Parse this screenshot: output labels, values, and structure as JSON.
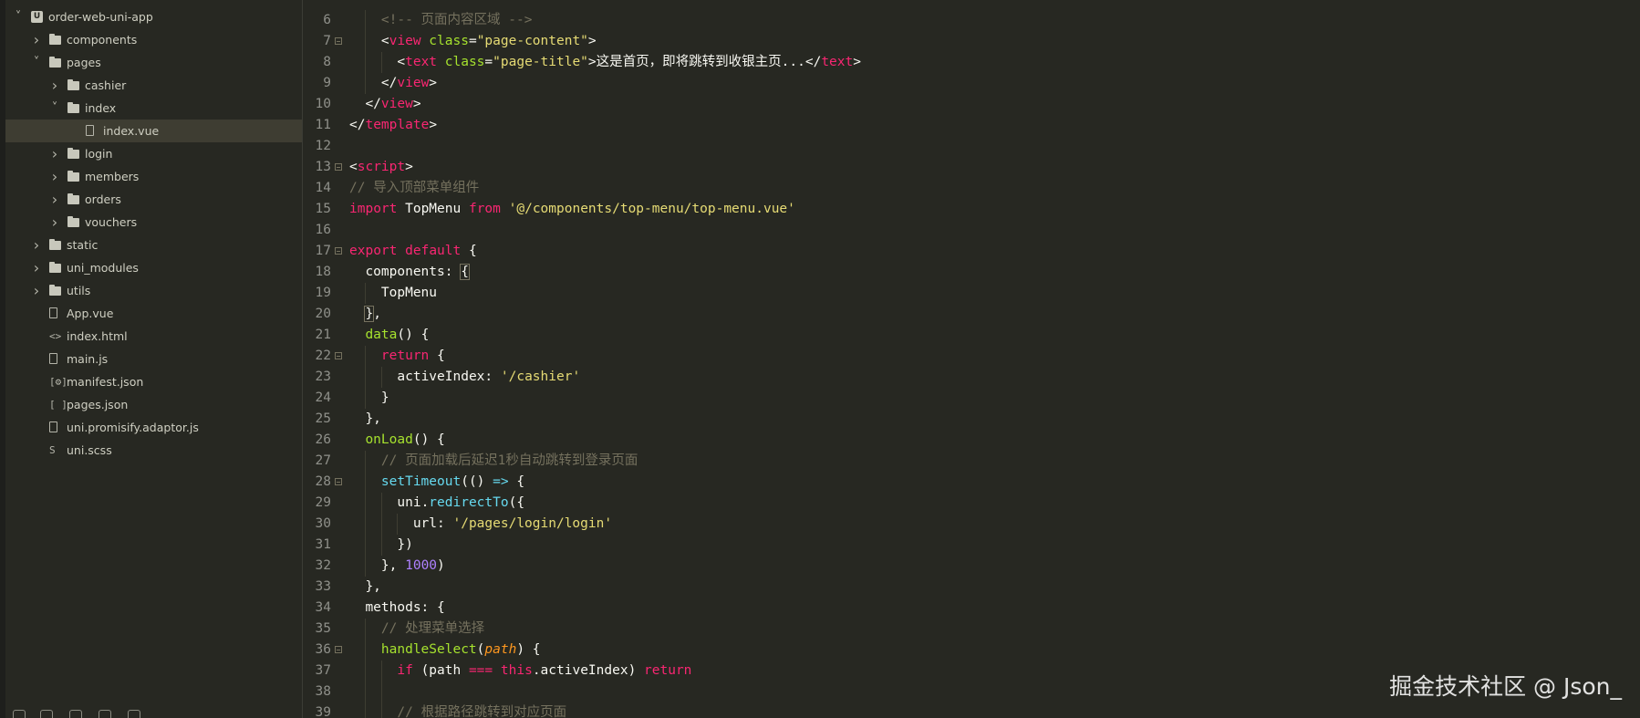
{
  "sidebar": {
    "items": [
      {
        "label": "order-web-uni-app",
        "depth": 0,
        "kind": "project",
        "expanded": true
      },
      {
        "label": "components",
        "depth": 1,
        "kind": "folder",
        "expanded": false
      },
      {
        "label": "pages",
        "depth": 1,
        "kind": "folder",
        "expanded": true
      },
      {
        "label": "cashier",
        "depth": 2,
        "kind": "folder",
        "expanded": false
      },
      {
        "label": "index",
        "depth": 2,
        "kind": "folder",
        "expanded": true
      },
      {
        "label": "index.vue",
        "depth": 3,
        "kind": "vue",
        "selected": true
      },
      {
        "label": "login",
        "depth": 2,
        "kind": "folder",
        "expanded": false
      },
      {
        "label": "members",
        "depth": 2,
        "kind": "folder",
        "expanded": false
      },
      {
        "label": "orders",
        "depth": 2,
        "kind": "folder",
        "expanded": false
      },
      {
        "label": "vouchers",
        "depth": 2,
        "kind": "folder",
        "expanded": false
      },
      {
        "label": "static",
        "depth": 1,
        "kind": "folder",
        "expanded": false
      },
      {
        "label": "uni_modules",
        "depth": 1,
        "kind": "folder",
        "expanded": false
      },
      {
        "label": "utils",
        "depth": 1,
        "kind": "folder",
        "expanded": false
      },
      {
        "label": "App.vue",
        "depth": 1,
        "kind": "vue"
      },
      {
        "label": "index.html",
        "depth": 1,
        "kind": "html"
      },
      {
        "label": "main.js",
        "depth": 1,
        "kind": "js"
      },
      {
        "label": "manifest.json",
        "depth": 1,
        "kind": "manifest"
      },
      {
        "label": "pages.json",
        "depth": 1,
        "kind": "json"
      },
      {
        "label": "uni.promisify.adaptor.js",
        "depth": 1,
        "kind": "js"
      },
      {
        "label": "uni.scss",
        "depth": 1,
        "kind": "scss"
      }
    ]
  },
  "editor": {
    "lines": [
      {
        "n": "6",
        "fold": false,
        "indent": 2,
        "tokens": [
          [
            "com",
            "<!-- 页面内容区域 -->"
          ]
        ]
      },
      {
        "n": "7",
        "fold": true,
        "indent": 2,
        "tokens": [
          [
            "pl",
            "<"
          ],
          [
            "tag",
            "view"
          ],
          [
            "pl",
            " "
          ],
          [
            "attr",
            "class"
          ],
          [
            "pl",
            "="
          ],
          [
            "str",
            "\"page-content\""
          ],
          [
            "pl",
            ">"
          ]
        ]
      },
      {
        "n": "8",
        "fold": false,
        "indent": 3,
        "tokens": [
          [
            "pl",
            "<"
          ],
          [
            "tag",
            "text"
          ],
          [
            "pl",
            " "
          ],
          [
            "attr",
            "class"
          ],
          [
            "pl",
            "="
          ],
          [
            "str",
            "\"page-title\""
          ],
          [
            "pl",
            ">这是首页，即将跳转到收银主页...</"
          ],
          [
            "tag",
            "text"
          ],
          [
            "pl",
            ">"
          ]
        ]
      },
      {
        "n": "9",
        "fold": false,
        "indent": 2,
        "tokens": [
          [
            "pl",
            "</"
          ],
          [
            "tag",
            "view"
          ],
          [
            "pl",
            ">"
          ]
        ]
      },
      {
        "n": "10",
        "fold": false,
        "indent": 1,
        "tokens": [
          [
            "pl",
            "</"
          ],
          [
            "tag",
            "view"
          ],
          [
            "pl",
            ">"
          ]
        ]
      },
      {
        "n": "11",
        "fold": false,
        "indent": 0,
        "tokens": [
          [
            "pl",
            "</"
          ],
          [
            "tag",
            "template"
          ],
          [
            "pl",
            ">"
          ]
        ]
      },
      {
        "n": "12",
        "fold": false,
        "indent": 0,
        "tokens": []
      },
      {
        "n": "13",
        "fold": true,
        "indent": 0,
        "tokens": [
          [
            "pl",
            "<"
          ],
          [
            "tag",
            "script"
          ],
          [
            "pl",
            ">"
          ]
        ]
      },
      {
        "n": "14",
        "fold": false,
        "indent": 0,
        "tokens": [
          [
            "com",
            "// 导入顶部菜单组件"
          ]
        ]
      },
      {
        "n": "15",
        "fold": false,
        "indent": 0,
        "tokens": [
          [
            "kw",
            "import"
          ],
          [
            "pl",
            " TopMenu "
          ],
          [
            "kw",
            "from"
          ],
          [
            "pl",
            " "
          ],
          [
            "str",
            "'@/components/top-menu/top-menu.vue'"
          ]
        ]
      },
      {
        "n": "16",
        "fold": false,
        "indent": 0,
        "tokens": []
      },
      {
        "n": "17",
        "fold": true,
        "indent": 0,
        "tokens": [
          [
            "kw",
            "export"
          ],
          [
            "pl",
            " "
          ],
          [
            "kw",
            "default"
          ],
          [
            "pl",
            " {"
          ]
        ]
      },
      {
        "n": "18",
        "fold": false,
        "indent": 1,
        "tokens": [
          [
            "pl",
            "components: "
          ],
          [
            "hl",
            "{"
          ]
        ]
      },
      {
        "n": "19",
        "fold": false,
        "indent": 2,
        "tokens": [
          [
            "pl",
            "TopMenu"
          ]
        ]
      },
      {
        "n": "20",
        "fold": false,
        "indent": 1,
        "tokens": [
          [
            "hl",
            "}"
          ],
          [
            "pl",
            ","
          ]
        ]
      },
      {
        "n": "21",
        "fold": false,
        "indent": 1,
        "tokens": [
          [
            "fn",
            "data"
          ],
          [
            "pl",
            "() {"
          ]
        ]
      },
      {
        "n": "22",
        "fold": true,
        "indent": 2,
        "tokens": [
          [
            "kw",
            "return"
          ],
          [
            "pl",
            " {"
          ]
        ]
      },
      {
        "n": "23",
        "fold": false,
        "indent": 3,
        "tokens": [
          [
            "pl",
            "activeIndex: "
          ],
          [
            "str",
            "'/cashier'"
          ]
        ]
      },
      {
        "n": "24",
        "fold": false,
        "indent": 2,
        "tokens": [
          [
            "pl",
            "}"
          ]
        ]
      },
      {
        "n": "25",
        "fold": false,
        "indent": 1,
        "tokens": [
          [
            "pl",
            "},"
          ]
        ]
      },
      {
        "n": "26",
        "fold": false,
        "indent": 1,
        "tokens": [
          [
            "fn",
            "onLoad"
          ],
          [
            "pl",
            "() {"
          ]
        ]
      },
      {
        "n": "27",
        "fold": false,
        "indent": 2,
        "tokens": [
          [
            "com",
            "// 页面加载后延迟1秒自动跳转到登录页面"
          ]
        ]
      },
      {
        "n": "28",
        "fold": true,
        "indent": 2,
        "tokens": [
          [
            "call",
            "setTimeout"
          ],
          [
            "pl",
            "(() "
          ],
          [
            "call",
            "=>"
          ],
          [
            "pl",
            " {"
          ]
        ]
      },
      {
        "n": "29",
        "fold": false,
        "indent": 3,
        "tokens": [
          [
            "pl",
            "uni."
          ],
          [
            "call",
            "redirectTo"
          ],
          [
            "pl",
            "({"
          ]
        ]
      },
      {
        "n": "30",
        "fold": false,
        "indent": 4,
        "tokens": [
          [
            "pl",
            "url: "
          ],
          [
            "str",
            "'/pages/login/login'"
          ]
        ]
      },
      {
        "n": "31",
        "fold": false,
        "indent": 3,
        "tokens": [
          [
            "pl",
            "})"
          ]
        ]
      },
      {
        "n": "32",
        "fold": false,
        "indent": 2,
        "tokens": [
          [
            "pl",
            "}, "
          ],
          [
            "num",
            "1000"
          ],
          [
            "pl",
            ")"
          ]
        ]
      },
      {
        "n": "33",
        "fold": false,
        "indent": 1,
        "tokens": [
          [
            "pl",
            "},"
          ]
        ]
      },
      {
        "n": "34",
        "fold": false,
        "indent": 1,
        "tokens": [
          [
            "pl",
            "methods: {"
          ]
        ]
      },
      {
        "n": "35",
        "fold": false,
        "indent": 2,
        "tokens": [
          [
            "com",
            "// 处理菜单选择"
          ]
        ]
      },
      {
        "n": "36",
        "fold": true,
        "indent": 2,
        "tokens": [
          [
            "fn",
            "handleSelect"
          ],
          [
            "pl",
            "("
          ],
          [
            "param",
            "path"
          ],
          [
            "pl",
            ") {"
          ]
        ]
      },
      {
        "n": "37",
        "fold": false,
        "indent": 3,
        "tokens": [
          [
            "kw",
            "if"
          ],
          [
            "pl",
            " (path "
          ],
          [
            "kw",
            "==="
          ],
          [
            "pl",
            " "
          ],
          [
            "kw",
            "this"
          ],
          [
            "pl",
            ".activeIndex) "
          ],
          [
            "kw",
            "return"
          ]
        ]
      },
      {
        "n": "38",
        "fold": false,
        "indent": 3,
        "tokens": []
      },
      {
        "n": "39",
        "fold": false,
        "indent": 3,
        "tokens": [
          [
            "com",
            "// 根据路径跳转到对应页面"
          ]
        ]
      }
    ]
  },
  "watermark": "掘金技术社区 @ Json_"
}
